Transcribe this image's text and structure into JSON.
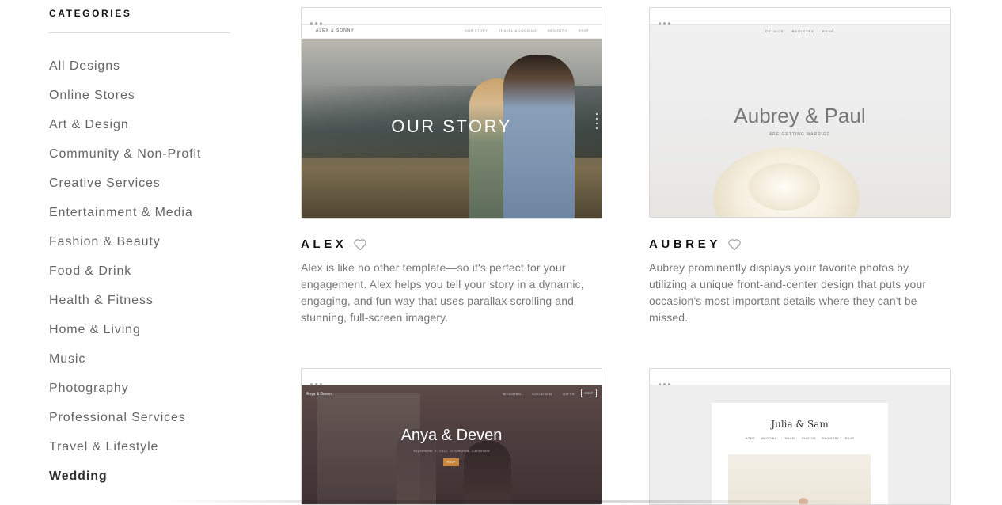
{
  "sidebar": {
    "heading": "CATEGORIES",
    "items": [
      {
        "label": "All Designs"
      },
      {
        "label": "Online Stores"
      },
      {
        "label": "Art & Design"
      },
      {
        "label": "Community & Non-Profit"
      },
      {
        "label": "Creative Services"
      },
      {
        "label": "Entertainment & Media"
      },
      {
        "label": "Fashion & Beauty"
      },
      {
        "label": "Food & Drink"
      },
      {
        "label": "Health & Fitness"
      },
      {
        "label": "Home & Living"
      },
      {
        "label": "Music"
      },
      {
        "label": "Photography"
      },
      {
        "label": "Professional Services"
      },
      {
        "label": "Travel & Lifestyle"
      },
      {
        "label": "Wedding"
      }
    ],
    "active_item": "Wedding"
  },
  "templates": [
    {
      "name": "ALEX",
      "description": "Alex is like no other template—so it's perfect for your engagement. Alex helps you tell your story in a dynamic, engaging, and fun way that uses parallax scrolling and stunning, full-screen imagery.",
      "preview": {
        "logo": "ALEX & SONNY",
        "nav": [
          "OUR STORY",
          "TRAVEL & LODGING",
          "REGISTRY",
          "RSVP"
        ],
        "overlay": "OUR STORY"
      }
    },
    {
      "name": "AUBREY",
      "description": "Aubrey prominently displays your favorite photos by utilizing a unique front-and-center design that puts your occasion's most important details where they can't be missed.",
      "preview": {
        "nav": [
          "DETAILS",
          "REGISTRY",
          "RSVP"
        ],
        "title": "Aubrey & Paul",
        "subtitle": "ARE GETTING MARRIED"
      }
    },
    {
      "preview": {
        "logo": "Anya & Deven",
        "nav": [
          "WEDDING",
          "LOCATION",
          "GIFTS"
        ],
        "button": "RSVP",
        "title": "Anya & Deven",
        "subtitle": "September 3, 2017 in Sonoma, California",
        "cta": "RSVP"
      }
    },
    {
      "preview": {
        "title": "Julia & Sam",
        "nav": [
          "HOME",
          "WEDDING",
          "TRAVEL",
          "PHOTOS",
          "REGISTRY",
          "RSVP"
        ]
      }
    }
  ],
  "colors": {
    "heading": "#111111",
    "category_text": "#666666",
    "description_text": "#777777",
    "anya_cta": "#c9863c"
  },
  "icons": {
    "favorite": "heart-outline-icon"
  }
}
